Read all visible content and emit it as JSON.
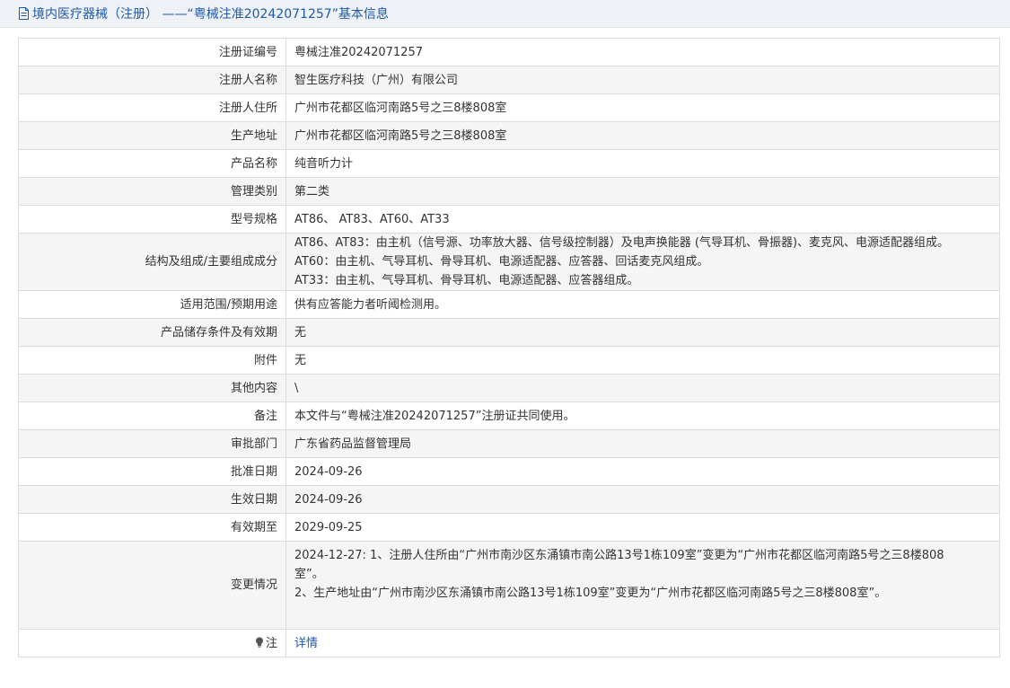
{
  "header": {
    "title": "境内医疗器械（注册） ——“粤械注准20242071257”基本信息"
  },
  "rows": [
    {
      "label": "注册证编号",
      "value": "粤械注准20242071257"
    },
    {
      "label": "注册人名称",
      "value": "智生医疗科技（广州）有限公司"
    },
    {
      "label": "注册人住所",
      "value": "广州市花都区临河南路5号之三8楼808室"
    },
    {
      "label": "生产地址",
      "value": "广州市花都区临河南路5号之三8楼808室"
    },
    {
      "label": "产品名称",
      "value": "纯音听力计"
    },
    {
      "label": "管理类别",
      "value": "第二类"
    },
    {
      "label": "型号规格",
      "value": "AT86、 AT83、AT60、AT33"
    },
    {
      "label": "结构及组成/主要组成成分",
      "lines": [
        "AT86、AT83：由主机（信号源、功率放大器、信号级控制器）及电声换能器 (气导耳机、骨振器)、麦克风、电源适配器组成。",
        "AT60：由主机、气导耳机、骨导耳机、电源适配器、应答器、回话麦克风组成。",
        "AT33：由主机、气导耳机、骨导耳机、电源适配器、应答器组成。"
      ]
    },
    {
      "label": "适用范围/预期用途",
      "value": "供有应答能力者听阈检测用。"
    },
    {
      "label": "产品储存条件及有效期",
      "value": "无"
    },
    {
      "label": "附件",
      "value": "无"
    },
    {
      "label": "其他内容",
      "value": "\\"
    },
    {
      "label": "备注",
      "value": "本文件与“粤械注准20242071257”注册证共同使用。"
    },
    {
      "label": "审批部门",
      "value": "广东省药品监督管理局"
    },
    {
      "label": "批准日期",
      "value": "2024-09-26"
    },
    {
      "label": "生效日期",
      "value": "2024-09-26"
    },
    {
      "label": "有效期至",
      "value": "2029-09-25"
    },
    {
      "label": "变更情况",
      "lines": [
        "2024-12-27: 1、注册人住所由“广州市南沙区东涌镇市南公路13号1栋109室”变更为“广州市花都区临河南路5号之三8楼808",
        "室”。",
        "2、生产地址由“广州市南沙区东涌镇市南公路13号1栋109室”变更为“广州市花都区临河南路5号之三8楼808室”。"
      ]
    }
  ],
  "note": {
    "label": "注",
    "link": "详情",
    "icon": "lightbulb-icon"
  },
  "colors": {
    "accent": "#1e5aa8",
    "border": "#dcdcdc",
    "row_alt": "#f5f5f5",
    "header_bg": "#eef1f5"
  }
}
